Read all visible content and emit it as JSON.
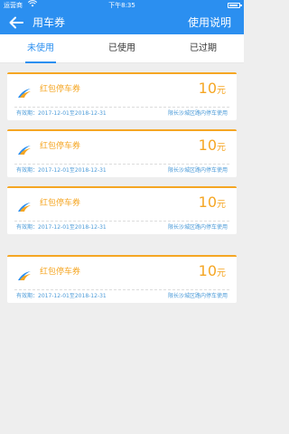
{
  "status_bar": {
    "carrier": "运营商",
    "time": "下午8:35",
    "battery_level": 0.85
  },
  "header": {
    "title": "用车券",
    "help_label": "使用说明",
    "back_icon": "arrow-left-icon"
  },
  "tabs": [
    {
      "label": "未使用",
      "active": true
    },
    {
      "label": "已使用",
      "active": false
    },
    {
      "label": "已过期",
      "active": false
    }
  ],
  "coupons": [
    {
      "name": "红包停车券",
      "amount": "10",
      "unit": "元",
      "validity": "有效期：2017-12-01至2018-12-31",
      "scope": "限长沙城区路内停车使用"
    },
    {
      "name": "红包停车券",
      "amount": "10",
      "unit": "元",
      "validity": "有效期：2017-12-01至2018-12-31",
      "scope": "限长沙城区路内停车使用"
    },
    {
      "name": "红包停车券",
      "amount": "10",
      "unit": "元",
      "validity": "有效期：2017-12-01至2018-12-31",
      "scope": "限长沙城区路内停车使用"
    },
    {
      "name": "红包停车券",
      "amount": "10",
      "unit": "元",
      "validity": "有效期：2017-12-01至2018-12-31",
      "scope": "限长沙城区路内停车使用"
    }
  ],
  "colors": {
    "primary": "#2b8ff0",
    "coupon_accent": "#f5a623",
    "coupon_meta": "#4a9ad8",
    "background": "#eeeeee"
  }
}
